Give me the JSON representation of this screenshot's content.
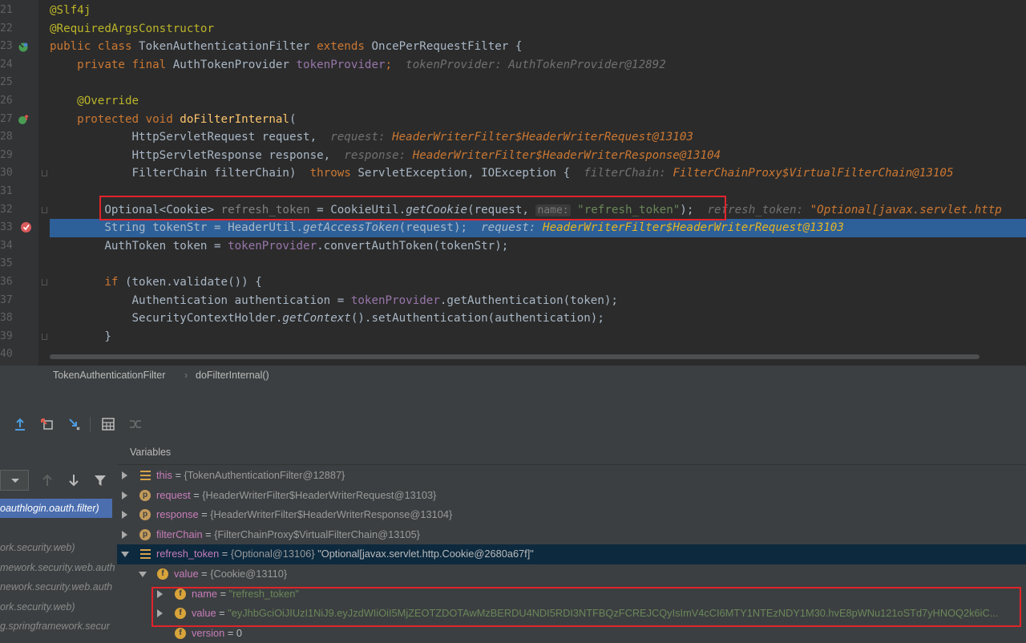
{
  "editor": {
    "line_numbers": [
      "21",
      "22",
      "23",
      "24",
      "25",
      "26",
      "27",
      "28",
      "29",
      "30",
      "31",
      "32",
      "33",
      "34",
      "35",
      "36",
      "37",
      "38",
      "39",
      "40"
    ],
    "lines": [
      [
        {
          "t": "@Slf4j",
          "c": "a"
        }
      ],
      [
        {
          "t": "@RequiredArgsConstructor",
          "c": "a"
        }
      ],
      [
        {
          "t": "public class ",
          "c": "k"
        },
        {
          "t": "TokenAuthenticationFilter "
        },
        {
          "t": "extends ",
          "c": "k"
        },
        {
          "t": "OncePerRequestFilter {"
        }
      ],
      [
        {
          "t": "    private final ",
          "c": "k"
        },
        {
          "t": "AuthTokenProvider "
        },
        {
          "t": "tokenProvider",
          "c": "f"
        },
        {
          "t": ";",
          "c": "k"
        },
        {
          "t": "  tokenProvider: AuthTokenProvider@12892",
          "c": "hint"
        }
      ],
      [],
      [
        {
          "t": "    @Override",
          "c": "a"
        }
      ],
      [
        {
          "t": "    protected void ",
          "c": "k"
        },
        {
          "t": "doFilterInternal",
          "c": "m"
        },
        {
          "t": "("
        }
      ],
      [
        {
          "t": "            HttpServletRequest request,"
        },
        {
          "t": "  request: ",
          "c": "hint"
        },
        {
          "t": "HeaderWriterFilter$HeaderWriterRequest@13103",
          "c": "hv"
        }
      ],
      [
        {
          "t": "            HttpServletResponse response,"
        },
        {
          "t": "  response: ",
          "c": "hint"
        },
        {
          "t": "HeaderWriterFilter$HeaderWriterResponse@13104",
          "c": "hv"
        }
      ],
      [
        {
          "t": "            FilterChain filterChain)  "
        },
        {
          "t": "throws ",
          "c": "k"
        },
        {
          "t": "ServletException, IOException {"
        },
        {
          "t": "  filterChain: ",
          "c": "hint"
        },
        {
          "t": "FilterChainProxy$VirtualFilterChain@13105",
          "c": "hv"
        }
      ],
      [],
      [
        {
          "t": "        Optional<Cookie> "
        },
        {
          "t": "refresh_token",
          "c": "cm"
        },
        {
          "t": " = CookieUtil."
        },
        {
          "t": "getCookie",
          "c": "st"
        },
        {
          "t": "(request, "
        },
        {
          "t": "name:",
          "c": "pn"
        },
        {
          "t": " "
        },
        {
          "t": "\"refresh_token\"",
          "c": "s"
        },
        {
          "t": ");"
        },
        {
          "t": "  refresh_token: ",
          "c": "hint"
        },
        {
          "t": "\"Optional[javax.servlet.http",
          "c": "hv"
        }
      ],
      [
        {
          "t": "        String tokenStr = HeaderUtil."
        },
        {
          "t": "getAccessToken",
          "c": "st"
        },
        {
          "t": "(request);"
        },
        {
          "t": "  request: ",
          "c": "hint"
        },
        {
          "t": "HeaderWriterFilter$HeaderWriterRequest@13103",
          "c": "hv"
        }
      ],
      [
        {
          "t": "        AuthToken token = "
        },
        {
          "t": "tokenProvider",
          "c": "f"
        },
        {
          "t": ".convertAuthToken(tokenStr);"
        }
      ],
      [],
      [
        {
          "t": "        if ",
          "c": "k"
        },
        {
          "t": "(token.validate()) {"
        }
      ],
      [
        {
          "t": "            Authentication authentication = "
        },
        {
          "t": "tokenProvider",
          "c": "f"
        },
        {
          "t": ".getAuthentication(token);"
        }
      ],
      [
        {
          "t": "            SecurityContextHolder."
        },
        {
          "t": "getContext",
          "c": "st"
        },
        {
          "t": "().setAuthentication(authentication);"
        }
      ],
      [
        {
          "t": "        }"
        }
      ],
      []
    ]
  },
  "breadcrumb": {
    "class_name": "TokenAuthenticationFilter",
    "method_name": "doFilterInternal()"
  },
  "debugger": {
    "variables_title": "Variables",
    "frames": [
      {
        "label": "oauthlogin.oauth.filter)",
        "selected": true
      },
      {
        "label": "",
        "selected": false
      },
      {
        "label": "ork.security.web)",
        "selected": false
      },
      {
        "label": "mework.security.web.auth",
        "selected": false
      },
      {
        "label": "nework.security.web.auth",
        "selected": false
      },
      {
        "label": "ork.security.web)",
        "selected": false
      },
      {
        "label": "g.springframework.secur",
        "selected": false
      }
    ],
    "variables": [
      {
        "name": "this",
        "eq": " = ",
        "type": "{TokenAuthenticationFilter@12887}",
        "val": "",
        "kind": "list",
        "expand": "right",
        "level": 0
      },
      {
        "name": "request",
        "eq": " = ",
        "type": "{HeaderWriterFilter$HeaderWriterRequest@13103}",
        "val": "",
        "kind": "p",
        "expand": "right",
        "level": 0
      },
      {
        "name": "response",
        "eq": " = ",
        "type": "{HeaderWriterFilter$HeaderWriterResponse@13104}",
        "val": "",
        "kind": "p",
        "expand": "right",
        "level": 0
      },
      {
        "name": "filterChain",
        "eq": " = ",
        "type": "{FilterChainProxy$VirtualFilterChain@13105}",
        "val": "",
        "kind": "p",
        "expand": "right",
        "level": 0
      },
      {
        "name": "refresh_token",
        "eq": " = ",
        "type": "{Optional@13106}",
        "val": " \"Optional[javax.servlet.http.Cookie@2680a67f]\"",
        "kind": "list",
        "expand": "down",
        "level": 0,
        "selected": true
      },
      {
        "name": "value",
        "eq": " = ",
        "type": "{Cookie@13110}",
        "val": "",
        "kind": "f",
        "expand": "down",
        "level": 1
      },
      {
        "name": "name",
        "eq": " = ",
        "type": "",
        "val": "\"refresh_token\"",
        "kind": "f",
        "expand": "right",
        "level": 2,
        "str": true
      },
      {
        "name": "value",
        "eq": " = ",
        "type": "",
        "val": "\"eyJhbGciOiJIUzI1NiJ9.eyJzdWIiOiI5MjZEOTZDOTAwMzBERDU4NDI5RDI3NTFBQzFCREJCQyIsImV4cCI6MTY1NTEzNDY1M30.hvE8pWNu121oSTd7yHNOQ2k6iC...",
        "kind": "f",
        "expand": "right",
        "level": 2,
        "str": true
      },
      {
        "name": "version",
        "eq": " = ",
        "type": "",
        "val": "0",
        "kind": "f",
        "expand": "none",
        "level": 2
      }
    ]
  }
}
